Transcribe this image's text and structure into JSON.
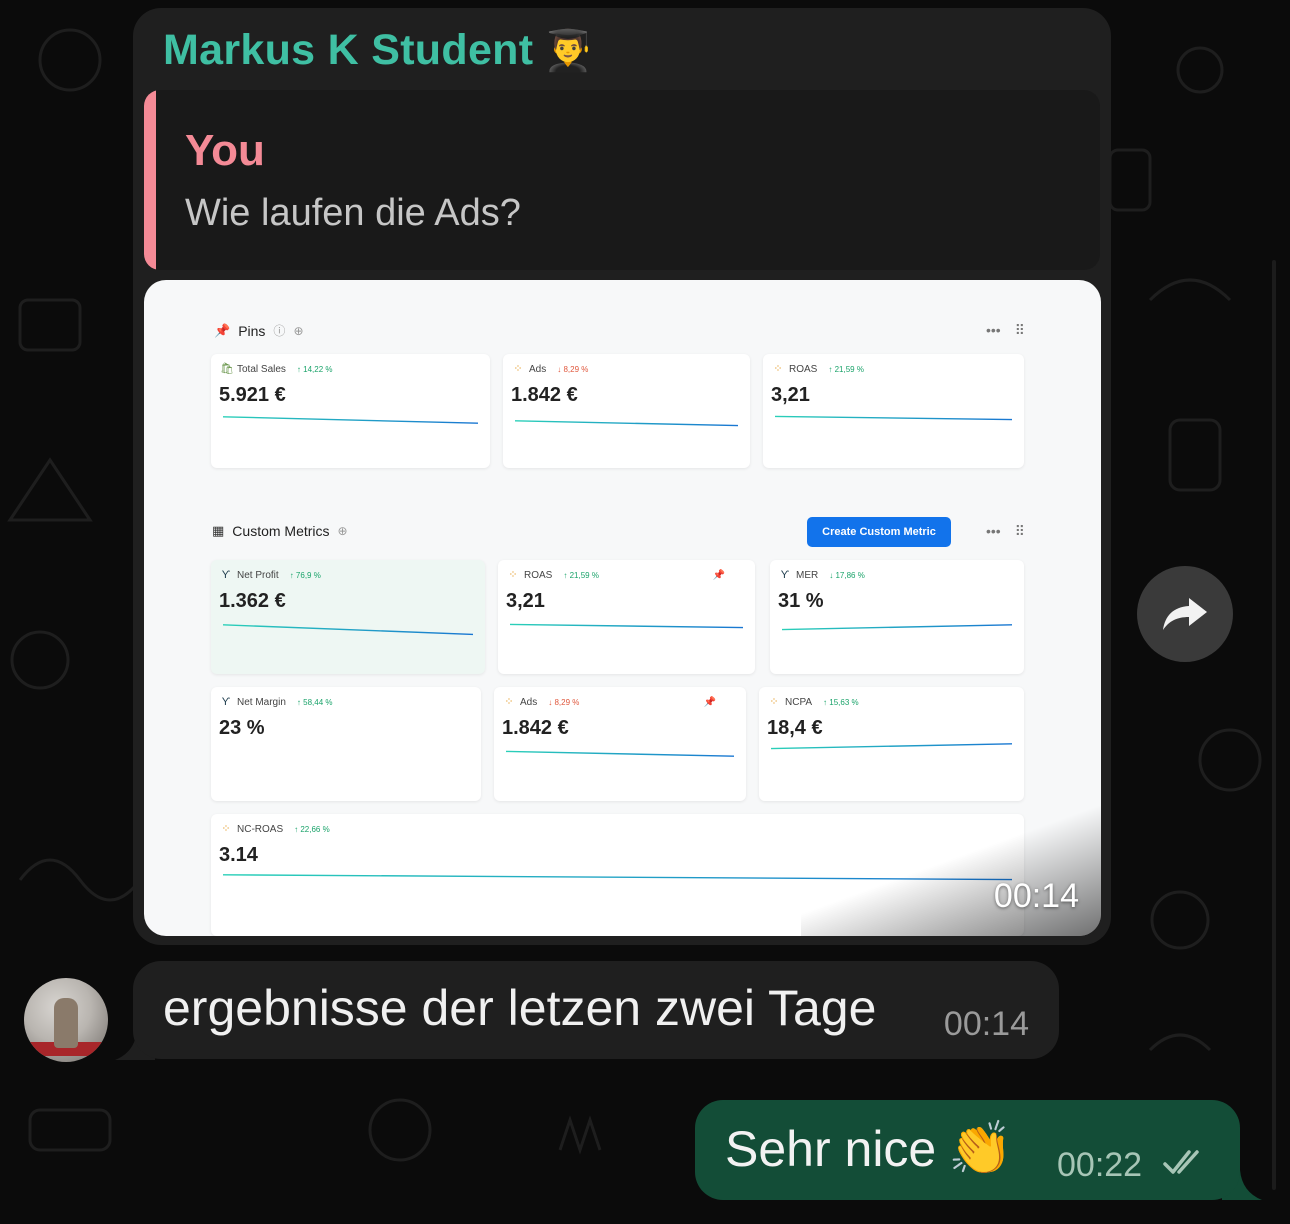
{
  "incoming_message": {
    "sender_name": "Markus K Student",
    "sender_emoji": "👨‍🎓",
    "reply_quote": {
      "author": "You",
      "text": "Wie laufen die Ads?"
    },
    "media_time": "00:14",
    "dashboard": {
      "pins_section": {
        "title": "Pins",
        "items": [
          {
            "label": "Total Sales",
            "delta": "14,22 %",
            "direction": "up",
            "value": "5.921 €"
          },
          {
            "label": "Ads",
            "delta": "8,29 %",
            "direction": "down",
            "value": "1.842 €"
          },
          {
            "label": "ROAS",
            "delta": "21,59 %",
            "direction": "up",
            "value": "3,21"
          }
        ]
      },
      "custom_section": {
        "title": "Custom Metrics",
        "create_button": "Create Custom Metric",
        "items": [
          {
            "label": "Net Profit",
            "delta": "76,9 %",
            "direction": "up",
            "value": "1.362 €"
          },
          {
            "label": "ROAS",
            "delta": "21,59 %",
            "direction": "up",
            "value": "3,21"
          },
          {
            "label": "MER",
            "delta": "17,86 %",
            "direction": "down",
            "value": "31 %"
          },
          {
            "label": "Net Margin",
            "delta": "58,44 %",
            "direction": "up",
            "value": "23 %"
          },
          {
            "label": "Ads",
            "delta": "8,29 %",
            "direction": "down",
            "value": "1.842 €"
          },
          {
            "label": "NCPA",
            "delta": "15,63 %",
            "direction": "up",
            "value": "18,4 €"
          },
          {
            "label": "NC-ROAS",
            "delta": "22,66 %",
            "direction": "up",
            "value": "3.14"
          }
        ]
      }
    }
  },
  "incoming_message_2": {
    "text": "ergebnisse der letzen zwei Tage",
    "time": "00:14"
  },
  "outgoing_message": {
    "text": "Sehr nice",
    "emoji": "👏",
    "time": "00:22",
    "status": "read"
  },
  "colors": {
    "sender": "#3fbfa3",
    "quote": "#f48a96",
    "outgoing_bg": "#134d37",
    "incoming_bg": "#1f1f1f",
    "accent_button": "#1273eb"
  },
  "icons": {
    "forward": "forward-arrow-icon",
    "read_receipt": "double-check-icon"
  }
}
